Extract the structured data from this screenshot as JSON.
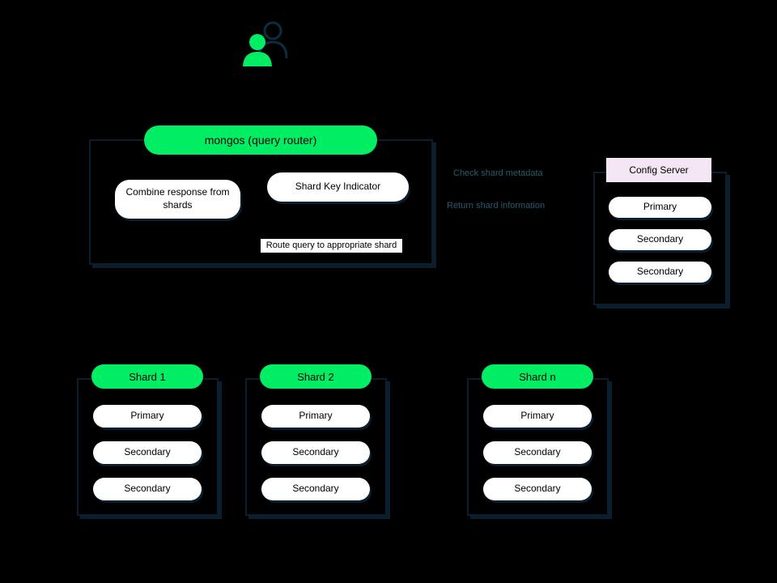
{
  "user_icon": "users-icon",
  "mongos": {
    "title": "mongos (query router)",
    "combine": "Combine response from shards",
    "shard_key": "Shard Key Indicator",
    "route": "Route query to appropriate shard"
  },
  "annotations": {
    "check_metadata": "Check shard metadata",
    "return_info": "Return shard information"
  },
  "config_server": {
    "title": "Config Server",
    "primary": "Primary",
    "secondary1": "Secondary",
    "secondary2": "Secondary"
  },
  "shards": {
    "shard1": {
      "title": "Shard 1",
      "primary": "Primary",
      "secondary1": "Secondary",
      "secondary2": "Secondary"
    },
    "shard2": {
      "title": "Shard 2",
      "primary": "Primary",
      "secondary1": "Secondary",
      "secondary2": "Secondary"
    },
    "shardn": {
      "title": "Shard n",
      "primary": "Primary",
      "secondary1": "Secondary",
      "secondary2": "Secondary"
    }
  }
}
